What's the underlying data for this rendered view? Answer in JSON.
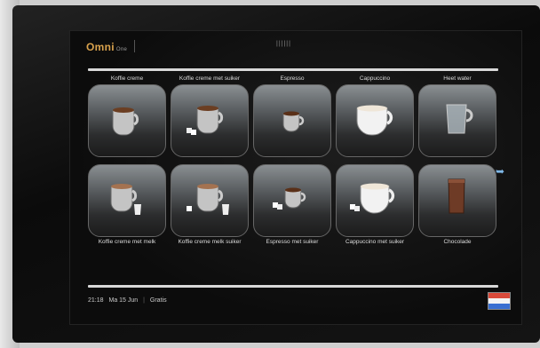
{
  "header": {
    "logo": "Omni",
    "logo_small": "One",
    "label": "||||||"
  },
  "products_top": [
    {
      "label": "Koffie creme",
      "icon": "cup-icon",
      "btn": "koffie-creme-button"
    },
    {
      "label": "Koffie creme met suiker",
      "icon": "cup-sugar-icon",
      "btn": "koffie-creme-suiker-button"
    },
    {
      "label": "Espresso",
      "icon": "espresso-icon",
      "btn": "espresso-button"
    },
    {
      "label": "Cappuccino",
      "icon": "cappuccino-icon",
      "btn": "cappuccino-button"
    },
    {
      "label": "Heet water",
      "icon": "glass-icon",
      "btn": "heet-water-button"
    }
  ],
  "products_bottom": [
    {
      "label": "Koffie creme met melk",
      "icon": "cup-milk-icon",
      "btn": "koffie-creme-melk-button"
    },
    {
      "label": "Koffie creme melk suiker",
      "icon": "cup-milk-sugar-icon",
      "btn": "koffie-creme-melk-suiker-button"
    },
    {
      "label": "Espresso met suiker",
      "icon": "espresso-sugar-icon",
      "btn": "espresso-suiker-button"
    },
    {
      "label": "Cappuccino met suiker",
      "icon": "cappuccino-sugar-icon",
      "btn": "cappuccino-suiker-button"
    },
    {
      "label": "Chocolade",
      "icon": "chocolate-icon",
      "btn": "chocolade-button"
    }
  ],
  "footer": {
    "time": "21:18",
    "date": "Ma 15 Jun",
    "price": "Gratis"
  },
  "language_flag": {
    "icon": "dutch-flag-icon",
    "colors": [
      "#d94a3a",
      "#f4f4f4",
      "#3a6fd1"
    ]
  }
}
